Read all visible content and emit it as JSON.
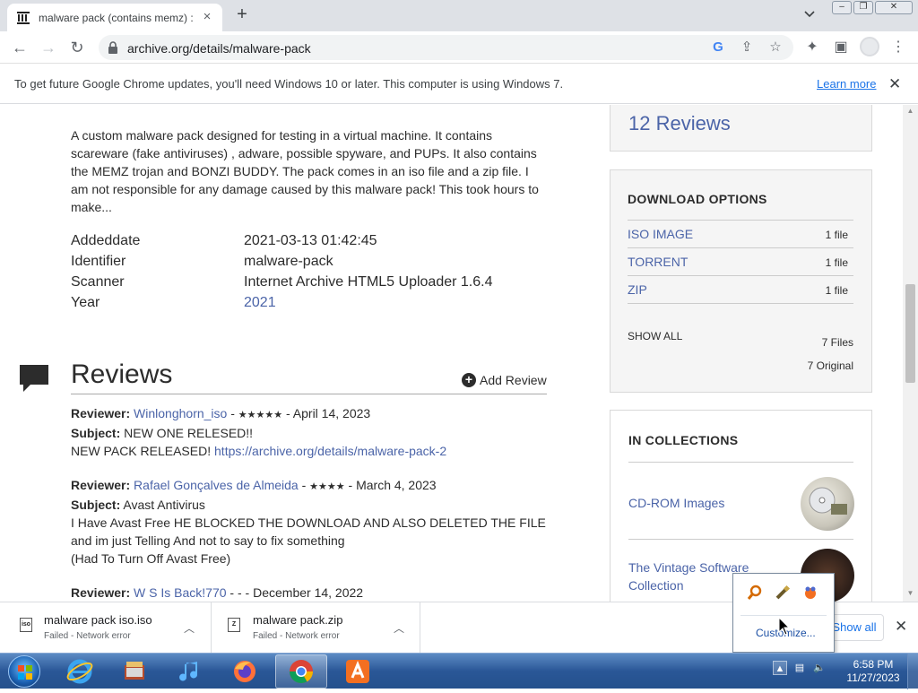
{
  "browser": {
    "tab_title": "malware pack (contains memz) :",
    "url": "archive.org/details/malware-pack"
  },
  "infobar": {
    "message": "To get future Google Chrome updates, you'll need Windows 10 or later. This computer is using Windows 7.",
    "link": "Learn more"
  },
  "description": "A custom malware pack designed for testing in a virtual machine. It contains scareware (fake antiviruses) , adware, possible spyware, and PUPs. It also contains the MEMZ trojan and BONZI BUDDY. The pack comes in an iso file and a zip file. I am not responsible for any damage caused by this malware pack! This took hours to make...",
  "metadata": [
    {
      "key": "Addeddate",
      "value": "2021-03-13 01:42:45"
    },
    {
      "key": "Identifier",
      "value": "malware-pack"
    },
    {
      "key": "Scanner",
      "value": "Internet Archive HTML5 Uploader 1.6.4"
    },
    {
      "key": "Year",
      "value": "2021"
    }
  ],
  "reviews": {
    "title": "Reviews",
    "add_label": "Add Review",
    "items": [
      {
        "reviewer_label": "Reviewer:",
        "reviewer": "Winlonghorn_iso",
        "stars": "★★★★★",
        "date": "April 14, 2023",
        "subject_label": "Subject:",
        "subject": "NEW ONE RELESED!!",
        "body": "NEW PACK RELEASED!",
        "body_link": "https://archive.org/details/malware-pack-2"
      },
      {
        "reviewer_label": "Reviewer:",
        "reviewer": "Rafael Gonçalves de Almeida",
        "stars": "★★★★",
        "date": "March 4, 2023",
        "subject_label": "Subject:",
        "subject": "Avast Antivirus",
        "body": "I Have Avast Free HE BLOCKED THE DOWNLOAD AND ALSO DELETED THE FILE and im just Telling And not to say to fix something",
        "body2": "(Had To Turn Off Avast Free)"
      },
      {
        "reviewer_label": "Reviewer:",
        "reviewer": "W S Is Back!770",
        "stars": "-",
        "date": "December 14, 2022"
      }
    ]
  },
  "sidebar": {
    "reviews_count": "12 Reviews",
    "download_title": "DOWNLOAD OPTIONS",
    "downloads": [
      {
        "label": "ISO IMAGE",
        "count": "1 file"
      },
      {
        "label": "TORRENT",
        "count": "1 file"
      },
      {
        "label": "ZIP",
        "count": "1 file"
      }
    ],
    "show_all": "SHOW ALL",
    "files_total": "7 Files",
    "files_original": "7 Original",
    "collections_title": "IN COLLECTIONS",
    "collections": [
      {
        "label": "CD-ROM Images"
      },
      {
        "label": "The Vintage Software Collection"
      }
    ]
  },
  "downloads_bar": {
    "items": [
      {
        "name": "malware pack iso.iso",
        "status": "Failed - Network error",
        "icon": "iso"
      },
      {
        "name": "malware pack.zip",
        "status": "Failed - Network error",
        "icon": "Z"
      }
    ],
    "show_all": "Show all"
  },
  "tray_popup": {
    "customize": "Customize..."
  },
  "taskbar": {
    "time": "6:58 PM",
    "date": "11/27/2023"
  }
}
